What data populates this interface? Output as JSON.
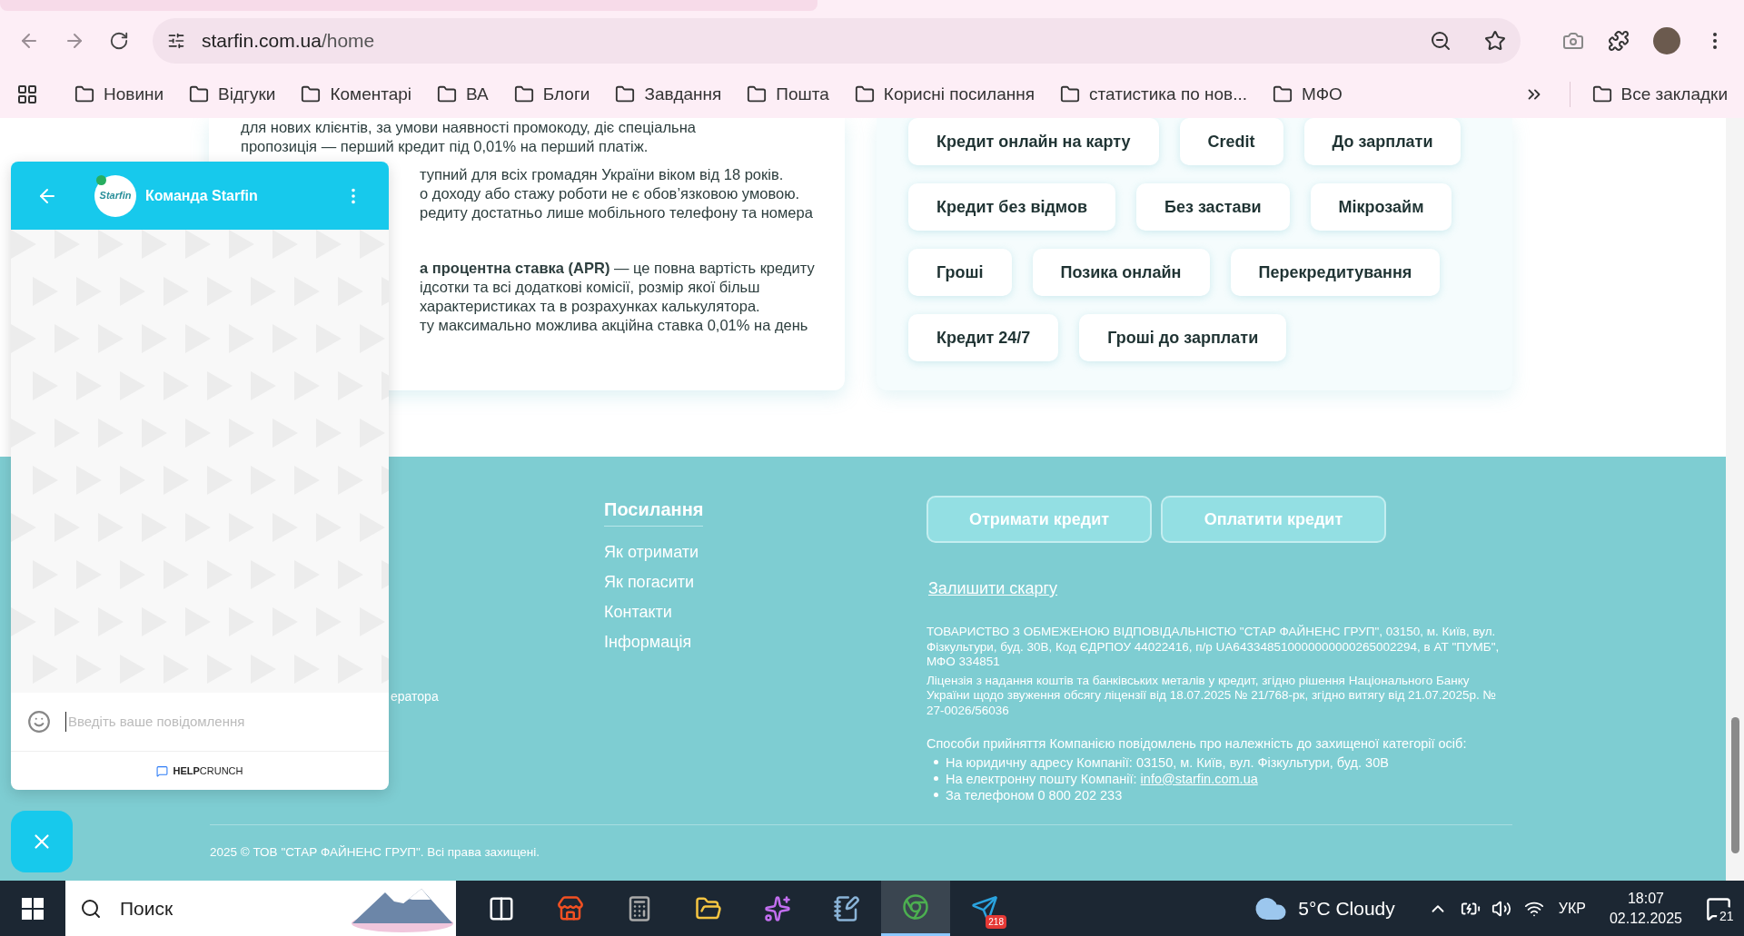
{
  "browser": {
    "url_host": "starfin.com.ua",
    "url_path": "/home",
    "bookmarks": [
      "Новини",
      "Відгуки",
      "Коментарі",
      "ВА",
      "Блоги",
      "Завдання",
      "Пошта",
      "Корисні посилання",
      "статистика по нов...",
      "МФО"
    ],
    "all_bookmarks": "Все закладки"
  },
  "content": {
    "paragraphs": [
      [
        "для нових клієнтів, за умови наявності промокоду, діє спеціальна",
        "пропозиція — перший кредит під 0,01% на перший платіж."
      ],
      [
        "тупний для всіх громадян України віком від 18 років.",
        "о доходу або стажу роботи не є обов’язковою умовою.",
        "редиту достатньо лише мобільного телефону та номера"
      ],
      [
        "**а процентна ставка (APR)** — це повна вартість кредиту",
        "ідсотки та всі додаткові комісії, розмір якої більш",
        "характеристиках та в розрахунках калькулятора.",
        "ту максимально можлива акційна ставка 0,01% на день"
      ]
    ],
    "tags": [
      "Кредит онлайн на карту",
      "Credit",
      "До зарплати",
      "Кредит без відмов",
      "Без застави",
      "Мікрозайм",
      "Гроші",
      "Позика онлайн",
      "Перекредитування",
      "Кредит 24/7",
      "Гроші до зарплати"
    ]
  },
  "footer": {
    "fragment": "ератора",
    "links_title": "Посилання",
    "links": [
      "Як отримати",
      "Як погасити",
      "Контакти",
      "Інформація"
    ],
    "buttons": [
      "Отримати кредит",
      "Оплатити кредит"
    ],
    "complaint_link": "Залишити скаргу",
    "legal": [
      "ТОВАРИСТВО З ОБМЕЖЕНОЮ ВІДПОВІДАЛЬНІСТЮ \"СТАР ФАЙНЕНС ГРУП\", 03150, м. Київ, вул. Фізкультури, буд. 30В, Код ЄДРПОУ 44022416, п/р UA643348510000000000265002294, в АТ \"ПУМБ\", МФО 334851",
      "Ліцензія з надання коштів та банківських металів у кредит, згідно рішення Національного Банку України щодо звуження обсягу ліцензії від 18.07.2025 № 21/768-рк, згідно витягу від 21.07.2025р. № 27-0026/56036"
    ],
    "ways_title": "Способи прийняття Компанією повідомлень про належність до захищеної категорії осіб:",
    "ways": [
      {
        "text": "На юридичну адресу Компанії: 03150, м. Київ, вул. Фізкультури, буд. 30В"
      },
      {
        "text": "На електронну пошту Компанії: ",
        "link": "info@starfin.com.ua"
      },
      {
        "text": "За телефоном 0 800 202 233"
      }
    ],
    "copyright": "2025 © ТОВ \"СТАР ФАЙНЕНС ГРУП\". Всі права захищені."
  },
  "chat": {
    "avatar_text": "Starfin",
    "online": true,
    "title": "Команда Starfin",
    "placeholder": "Введіть ваше повідомлення",
    "powered_by": "**HELP**CRUNCH"
  },
  "taskbar": {
    "search_placeholder": "Поиск",
    "apps": [
      {
        "selected": false
      },
      {
        "selected": false
      },
      {
        "selected": false
      },
      {
        "selected": false
      },
      {
        "selected": false
      },
      {
        "selected": false
      },
      {
        "selected": true
      },
      {
        "selected": false,
        "badge": "218"
      }
    ],
    "weather": "5°C Cloudy",
    "language": "УКР",
    "time": "18:07",
    "date": "02.12.2025",
    "notifications": "21"
  }
}
